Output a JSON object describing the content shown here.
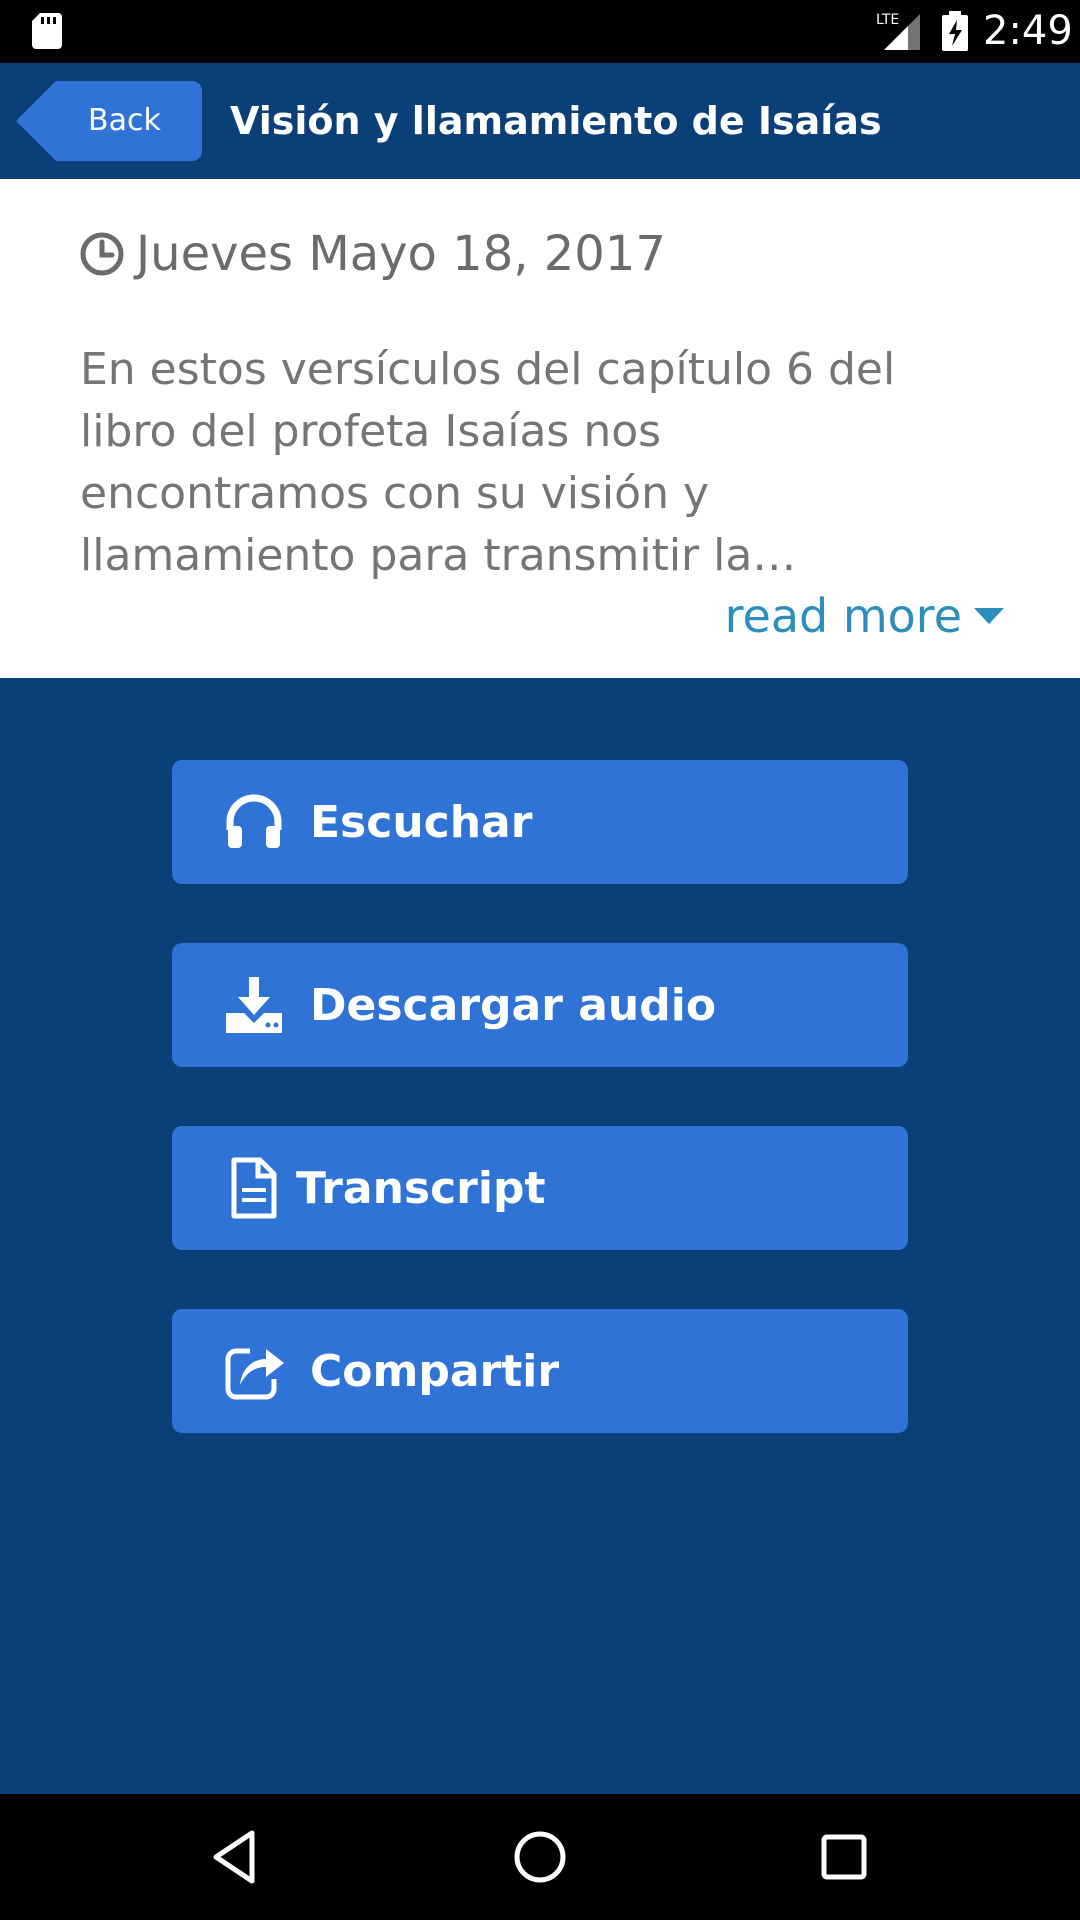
{
  "status_bar": {
    "time": "2:49",
    "network_label": "LTE",
    "icons": [
      "sd-card-icon",
      "signal-icon",
      "battery-charging-icon"
    ]
  },
  "app_bar": {
    "back_label": "Back",
    "title": "Visión y llamamiento de Isaías",
    "background": "#0a3f78",
    "back_color": "#2f73d6"
  },
  "episode": {
    "date": "Jueves Mayo 18, 2017",
    "description": "En estos versículos del capítulo 6 del\nlibro del profeta Isaías nos\nencontramos con su visión y\nllamamiento para transmitir la…",
    "read_more_label": "read more",
    "link_color": "#2a8fbd"
  },
  "actions": [
    {
      "label": "Escuchar",
      "icon": "headphones-icon"
    },
    {
      "label": "Descargar audio",
      "icon": "download-icon"
    },
    {
      "label": "Transcript",
      "icon": "document-icon"
    },
    {
      "label": "Compartir",
      "icon": "share-icon"
    }
  ],
  "action_color": "#2f73d6",
  "nav_bar": {
    "icons": [
      "back-triangle-icon",
      "home-circle-icon",
      "recents-square-icon"
    ]
  }
}
